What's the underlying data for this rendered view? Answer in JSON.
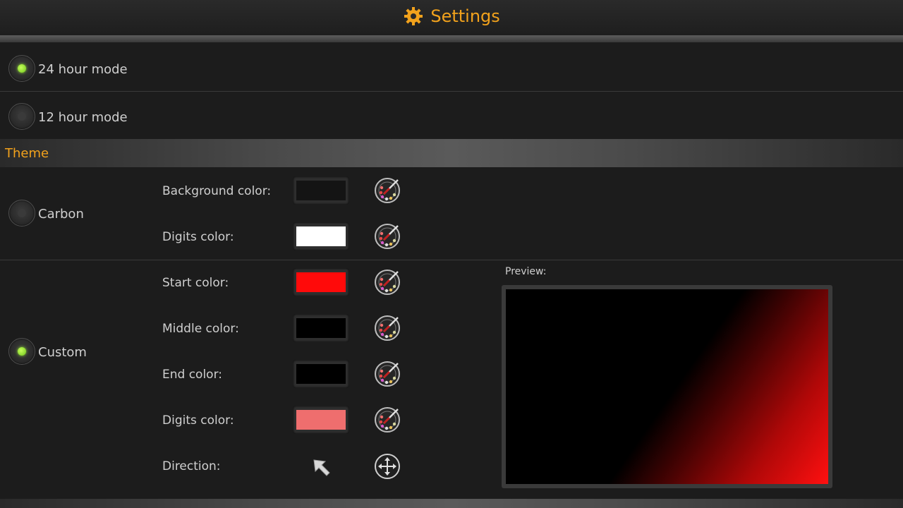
{
  "header": {
    "title": "Settings",
    "icon": "gear-icon",
    "accent": "#f2a21c"
  },
  "time_mode": {
    "options": [
      {
        "label": "24 hour mode",
        "selected": true
      },
      {
        "label": "12 hour mode",
        "selected": false
      }
    ]
  },
  "theme": {
    "section_label": "Theme",
    "carbon": {
      "label": "Carbon",
      "selected": false,
      "fields": [
        {
          "label": "Background color:",
          "color": "#141414"
        },
        {
          "label": "Digits color:",
          "color": "#ffffff"
        }
      ]
    },
    "custom": {
      "label": "Custom",
      "selected": true,
      "fields": [
        {
          "label": "Start color:",
          "color": "#ff0a0a"
        },
        {
          "label": "Middle color:",
          "color": "#000000"
        },
        {
          "label": "End color:",
          "color": "#000000"
        },
        {
          "label": "Digits color:",
          "color": "#ef6e6e"
        }
      ],
      "direction_label": "Direction:",
      "direction_icon": "arrow-up-left-icon",
      "direction_button_icon": "move-arrows-icon",
      "preview_label": "Preview:"
    }
  },
  "picker_icon": "color-palette-icon"
}
